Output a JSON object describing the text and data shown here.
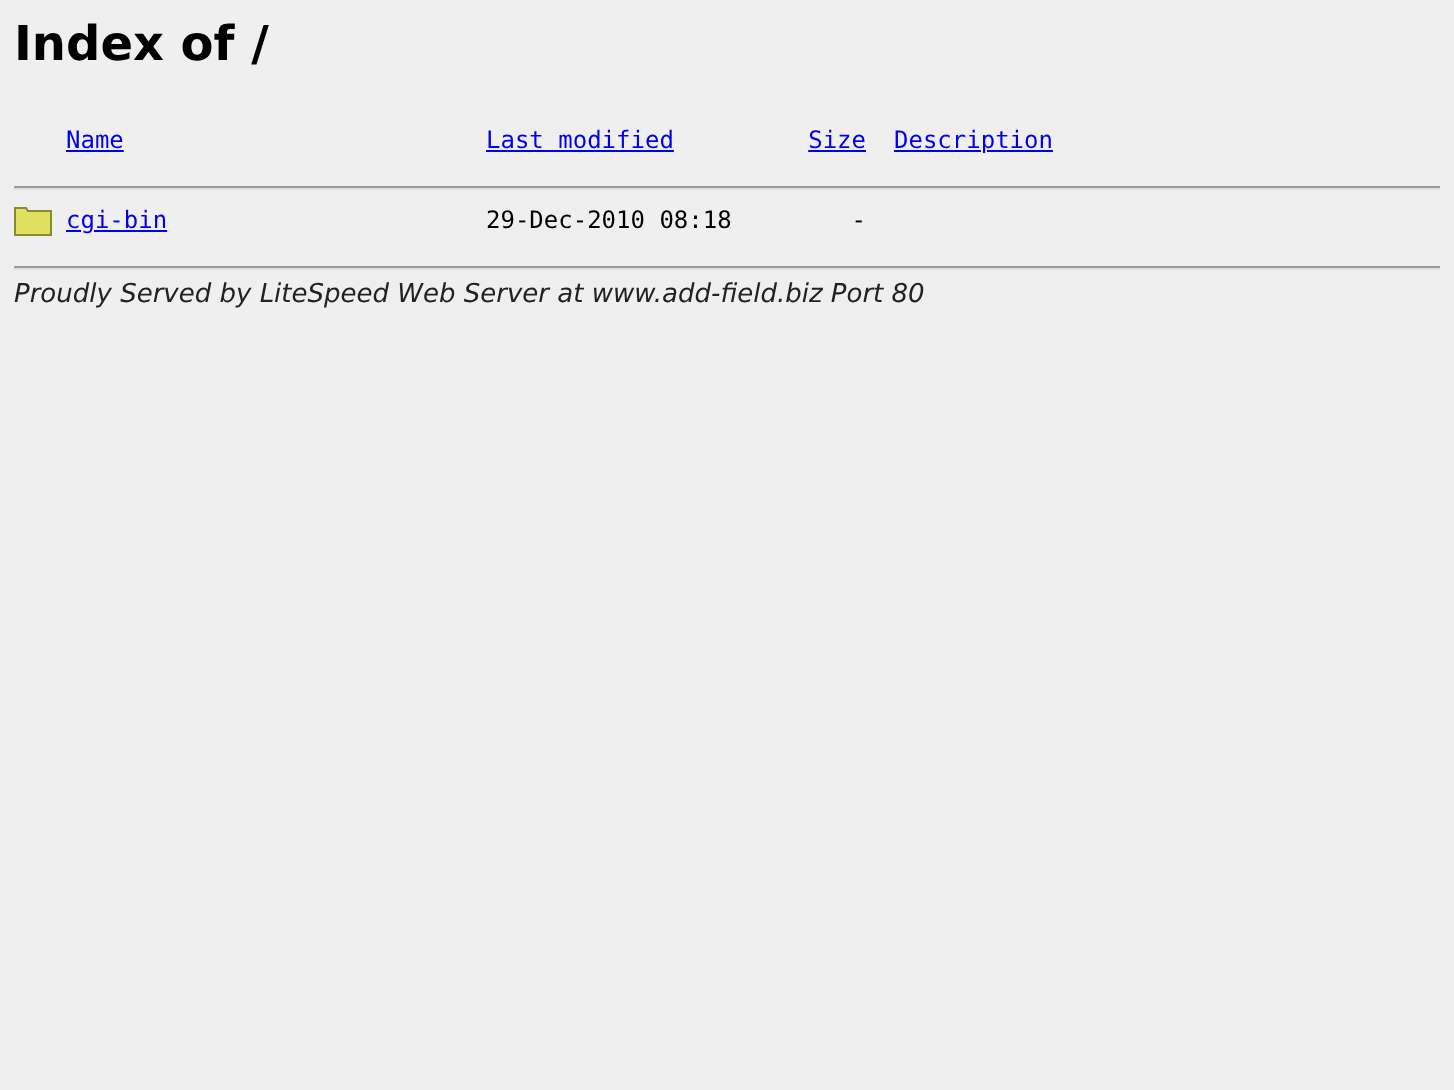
{
  "title": "Index of /",
  "columns": [
    {
      "label": "Name"
    },
    {
      "label": "Last modified"
    },
    {
      "label": "Size"
    },
    {
      "label": "Description"
    }
  ],
  "rows": [
    {
      "kind": "folder",
      "name": "cgi-bin",
      "modified": "29-Dec-2010 08:18",
      "size": "-"
    }
  ],
  "footer": "Proudly Served by LiteSpeed Web Server at www.add-field.biz Port 80"
}
